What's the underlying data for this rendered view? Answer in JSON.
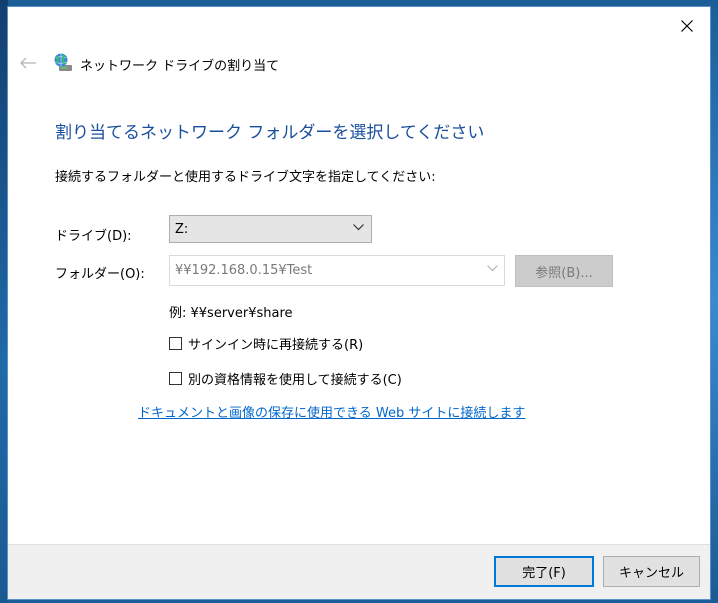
{
  "window": {
    "title": "ネットワーク ドライブの割り当て",
    "close_icon": "close-icon",
    "back_icon": "back-arrow-icon",
    "app_icon": "network-drive-icon"
  },
  "content": {
    "heading": "割り当てるネットワーク フォルダーを選択してください",
    "instruction": "接続するフォルダーと使用するドライブ文字を指定してください:",
    "drive_label": "ドライブ(D):",
    "drive_value": "Z:",
    "folder_label": "フォルダー(O):",
    "folder_value": "¥¥192.168.0.15¥Test",
    "browse_label": "参照(B)...",
    "example": "例: ¥¥server¥share",
    "reconnect_label": "サインイン時に再接続する(R)",
    "reconnect_checked": false,
    "credentials_label": "別の資格情報を使用して接続する(C)",
    "credentials_checked": false,
    "link": "ドキュメントと画像の保存に使用できる Web サイトに接続します"
  },
  "footer": {
    "finish_label": "完了(F)",
    "cancel_label": "キャンセル"
  },
  "colors": {
    "heading": "#1a4f9c",
    "link": "#0066cc",
    "primary_border": "#0078d7"
  }
}
